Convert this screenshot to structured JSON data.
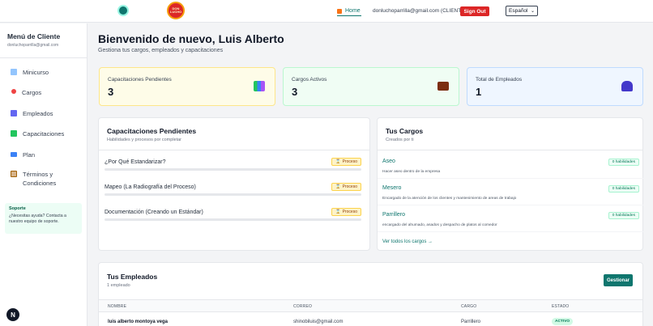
{
  "topnav": {
    "logo_text": "DON LUCHO",
    "home_label": "Home",
    "user_label": "donluchoparrilla@gmail.com (CLIENT)",
    "signout_label": "Sign Out",
    "language": "Español"
  },
  "sidebar": {
    "title": "Menú de Cliente",
    "email": "donluchoparrilla@gmail.com",
    "items": [
      {
        "label": "Minicurso",
        "icon": "book-icon",
        "color": "#60a5fa"
      },
      {
        "label": "Cargos",
        "icon": "pin-icon",
        "color": "#ef4444"
      },
      {
        "label": "Empleados",
        "icon": "users-icon",
        "color": "#6366f1"
      },
      {
        "label": "Capacitaciones",
        "icon": "books-icon",
        "color": "#22c55e"
      },
      {
        "label": "Plan",
        "icon": "card-icon",
        "color": "#3b82f6"
      },
      {
        "label": "Términos y Condiciones",
        "label_line1": "Términos y",
        "label_line2": "Condiciones",
        "icon": "clipboard-icon",
        "color": "#a16207"
      }
    ],
    "support": {
      "title": "Soporte",
      "text": "¿Necesitas ayuda? Contacta a nuestro equipo de soporte."
    },
    "badge": "N"
  },
  "main": {
    "title": "Bienvenido de nuevo, Luis Alberto",
    "subtitle": "Gestiona tus cargos, empleados y capacitaciones",
    "stats": [
      {
        "label": "Capacitaciones Pendientes",
        "value": "3",
        "bg": "#fefce8",
        "border": "#fde68a",
        "icon": "books-icon"
      },
      {
        "label": "Cargos Activos",
        "value": "3",
        "bg": "#f0fdf4",
        "border": "#bbf7d0",
        "icon": "briefcase-icon"
      },
      {
        "label": "Total de Empleados",
        "value": "1",
        "bg": "#eff6ff",
        "border": "#bfdbfe",
        "icon": "users-icon"
      }
    ],
    "capacitaciones": {
      "title": "Capacitaciones Pendientes",
      "subtitle": "Habilidades y procesos por completar",
      "items": [
        {
          "title": "¿Por Qué Estandarizar?",
          "status": "Proceso",
          "progress": 0
        },
        {
          "title": "Mapeo (La Radiografía del Proceso)",
          "status": "Proceso",
          "progress": 0
        },
        {
          "title": "Documentación (Creando un Estándar)",
          "status": "Proceso",
          "progress": 0
        }
      ]
    },
    "cargos": {
      "title": "Tus Cargos",
      "subtitle": "Creados por ti",
      "items": [
        {
          "title": "Aseo",
          "desc": "Hacer aseo dentro de la empresa",
          "badge": "0 habilidades"
        },
        {
          "title": "Mesero",
          "desc": "Encargado de la atención de los clientes y mantenimiento de areas de trabajo",
          "badge": "0 habilidades"
        },
        {
          "title": "Parrillero",
          "desc": "encargado del ahumado, asados y despacho de platos al comedor",
          "badge": "0 habilidades"
        }
      ],
      "see_all": "Ver todos los cargos →"
    },
    "empleados": {
      "title": "Tus Empleados",
      "subtitle": "1 empleado",
      "manage_label": "Gestionar",
      "columns": [
        "NOMBRE",
        "CORREO",
        "CARGO",
        "ESTADO"
      ],
      "rows": [
        {
          "nombre": "luis alberto montoya vega",
          "correo": "shinobiluis@gmail.com",
          "cargo": "Parrillero",
          "estado": "ACTIVO"
        }
      ]
    }
  }
}
